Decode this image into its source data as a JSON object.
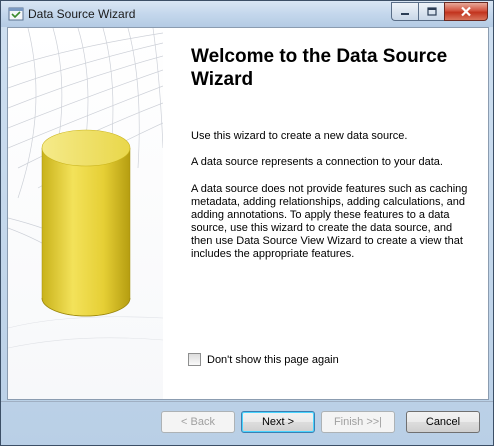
{
  "window": {
    "title": "Data Source Wizard",
    "icon": "wizard-app-icon"
  },
  "main": {
    "heading": "Welcome to the Data Source Wizard",
    "paragraphs": [
      "Use this wizard to create a new data source.",
      "A data source represents a connection to your data.",
      "A data source does not provide features such as caching metadata, adding relationships, adding calculations, and adding annotations. To apply these features to a data source, use this wizard to create the data source, and then use Data Source View Wizard to create a view that includes the appropriate features."
    ],
    "checkbox_label": "Don't show this page again",
    "checkbox_checked": false
  },
  "buttons": {
    "back": "< Back",
    "next": "Next >",
    "finish": "Finish >>|",
    "cancel": "Cancel"
  },
  "colors": {
    "cylinder": "#e8d23c",
    "title_bar": "#c4d7ec",
    "close_button": "#c2331e"
  }
}
